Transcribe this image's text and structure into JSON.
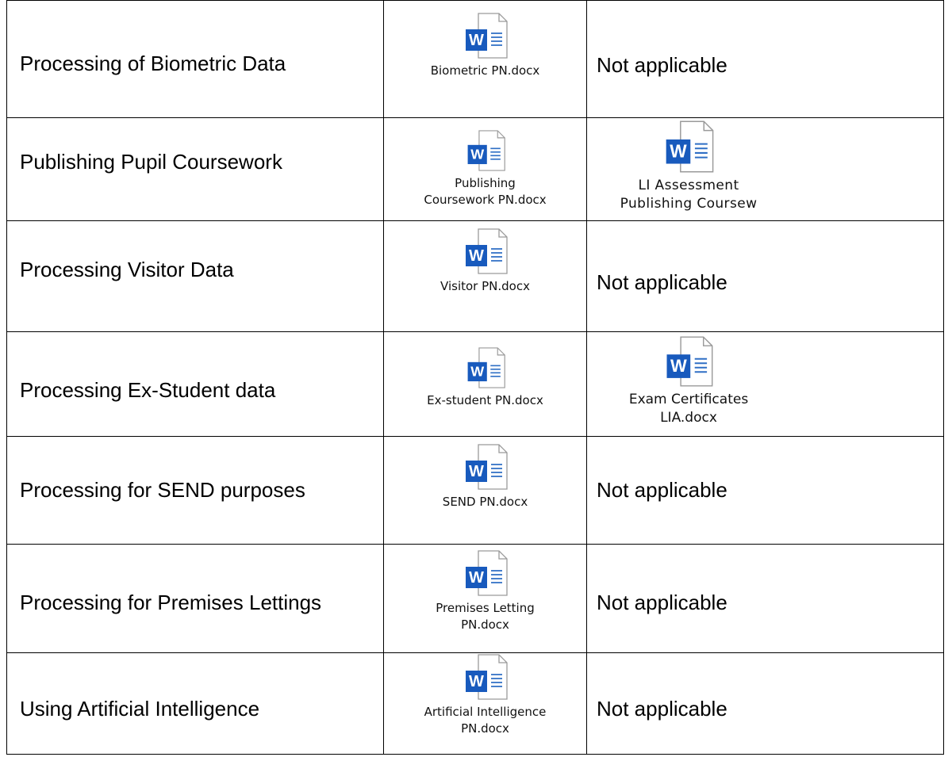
{
  "rows": [
    {
      "title": "Processing of Biometric Data",
      "notice_file": "Biometric PN.docx",
      "assessment_text": "Not applicable"
    },
    {
      "title": "Publishing Pupil Coursework",
      "notice_file_line1": "Publishing",
      "notice_file_line2": "Coursework PN.docx",
      "assessment_file_line1": "LI Assessment",
      "assessment_file_line2": "Publishing Coursew"
    },
    {
      "title": "Processing Visitor Data",
      "notice_file": "Visitor PN.docx",
      "assessment_text": "Not applicable"
    },
    {
      "title": "Processing Ex-Student data",
      "notice_file": "Ex-student PN.docx",
      "assessment_file_line1": "Exam Certificates",
      "assessment_file_line2": "LIA.docx"
    },
    {
      "title": "Processing for SEND purposes",
      "notice_file": "SEND PN.docx",
      "assessment_text": "Not applicable"
    },
    {
      "title": "Processing for Premises Lettings",
      "notice_file_line1": "Premises Letting",
      "notice_file_line2": "PN.docx",
      "assessment_text": "Not applicable"
    },
    {
      "title": "Using Artificial Intelligence",
      "notice_file_line1": "Artificial Intelligence",
      "notice_file_line2": "PN.docx",
      "assessment_text": "Not applicable"
    }
  ],
  "icon": {
    "name": "word-document-icon",
    "letter": "W",
    "accent": "#185abd"
  }
}
